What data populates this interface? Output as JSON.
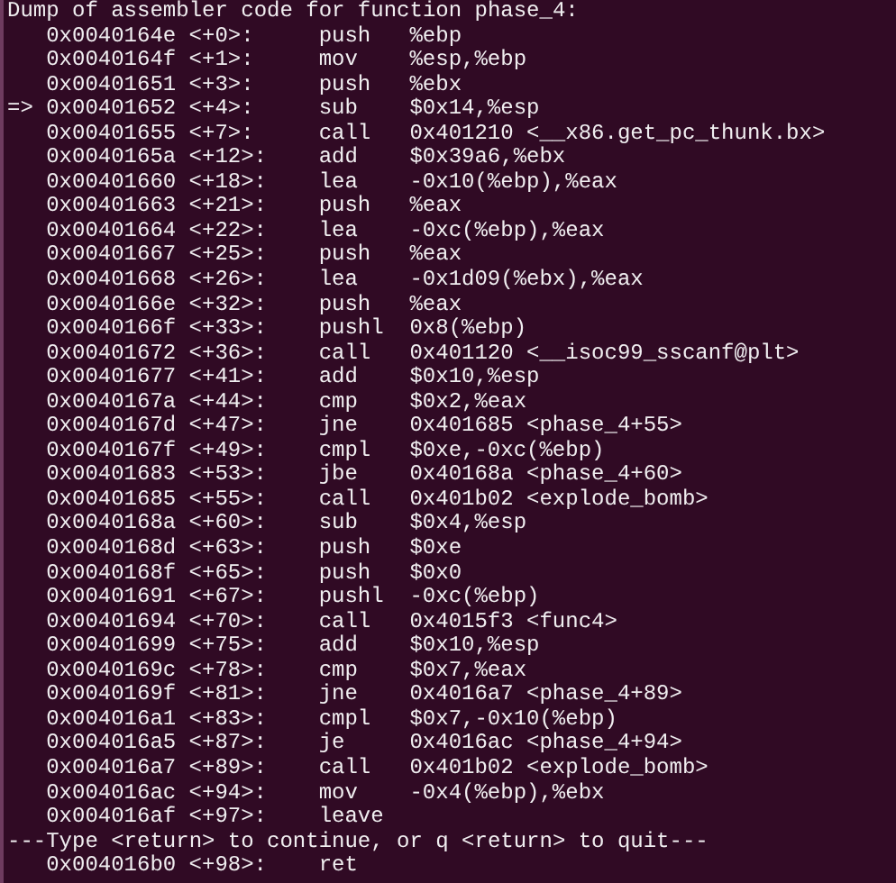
{
  "header": "Dump of assembler code for function phase_4:",
  "lines": [
    {
      "kind": "instruction",
      "address": "0x0040164e",
      "offset": "<+0>:",
      "mnemonic": "push",
      "operands": "%ebp"
    },
    {
      "kind": "instruction",
      "address": "0x0040164f",
      "offset": "<+1>:",
      "mnemonic": "mov",
      "operands": "%esp,%ebp"
    },
    {
      "kind": "instruction",
      "address": "0x00401651",
      "offset": "<+3>:",
      "mnemonic": "push",
      "operands": "%ebx"
    },
    {
      "kind": "instruction",
      "marker": "=>",
      "address": "0x00401652",
      "offset": "<+4>:",
      "mnemonic": "sub",
      "operands": "$0x14,%esp"
    },
    {
      "kind": "instruction",
      "address": "0x00401655",
      "offset": "<+7>:",
      "mnemonic": "call",
      "operands": "0x401210 <__x86.get_pc_thunk.bx>"
    },
    {
      "kind": "instruction",
      "address": "0x0040165a",
      "offset": "<+12>:",
      "mnemonic": "add",
      "operands": "$0x39a6,%ebx"
    },
    {
      "kind": "instruction",
      "address": "0x00401660",
      "offset": "<+18>:",
      "mnemonic": "lea",
      "operands": "-0x10(%ebp),%eax"
    },
    {
      "kind": "instruction",
      "address": "0x00401663",
      "offset": "<+21>:",
      "mnemonic": "push",
      "operands": "%eax"
    },
    {
      "kind": "instruction",
      "address": "0x00401664",
      "offset": "<+22>:",
      "mnemonic": "lea",
      "operands": "-0xc(%ebp),%eax"
    },
    {
      "kind": "instruction",
      "address": "0x00401667",
      "offset": "<+25>:",
      "mnemonic": "push",
      "operands": "%eax"
    },
    {
      "kind": "instruction",
      "address": "0x00401668",
      "offset": "<+26>:",
      "mnemonic": "lea",
      "operands": "-0x1d09(%ebx),%eax"
    },
    {
      "kind": "instruction",
      "address": "0x0040166e",
      "offset": "<+32>:",
      "mnemonic": "push",
      "operands": "%eax"
    },
    {
      "kind": "instruction",
      "address": "0x0040166f",
      "offset": "<+33>:",
      "mnemonic": "pushl",
      "operands": "0x8(%ebp)"
    },
    {
      "kind": "instruction",
      "address": "0x00401672",
      "offset": "<+36>:",
      "mnemonic": "call",
      "operands": "0x401120 <__isoc99_sscanf@plt>"
    },
    {
      "kind": "instruction",
      "address": "0x00401677",
      "offset": "<+41>:",
      "mnemonic": "add",
      "operands": "$0x10,%esp"
    },
    {
      "kind": "instruction",
      "address": "0x0040167a",
      "offset": "<+44>:",
      "mnemonic": "cmp",
      "operands": "$0x2,%eax"
    },
    {
      "kind": "instruction",
      "address": "0x0040167d",
      "offset": "<+47>:",
      "mnemonic": "jne",
      "operands": "0x401685 <phase_4+55>"
    },
    {
      "kind": "instruction",
      "address": "0x0040167f",
      "offset": "<+49>:",
      "mnemonic": "cmpl",
      "operands": "$0xe,-0xc(%ebp)"
    },
    {
      "kind": "instruction",
      "address": "0x00401683",
      "offset": "<+53>:",
      "mnemonic": "jbe",
      "operands": "0x40168a <phase_4+60>"
    },
    {
      "kind": "instruction",
      "address": "0x00401685",
      "offset": "<+55>:",
      "mnemonic": "call",
      "operands": "0x401b02 <explode_bomb>"
    },
    {
      "kind": "instruction",
      "address": "0x0040168a",
      "offset": "<+60>:",
      "mnemonic": "sub",
      "operands": "$0x4,%esp"
    },
    {
      "kind": "instruction",
      "address": "0x0040168d",
      "offset": "<+63>:",
      "mnemonic": "push",
      "operands": "$0xe"
    },
    {
      "kind": "instruction",
      "address": "0x0040168f",
      "offset": "<+65>:",
      "mnemonic": "push",
      "operands": "$0x0"
    },
    {
      "kind": "instruction",
      "address": "0x00401691",
      "offset": "<+67>:",
      "mnemonic": "pushl",
      "operands": "-0xc(%ebp)"
    },
    {
      "kind": "instruction",
      "address": "0x00401694",
      "offset": "<+70>:",
      "mnemonic": "call",
      "operands": "0x4015f3 <func4>"
    },
    {
      "kind": "instruction",
      "address": "0x00401699",
      "offset": "<+75>:",
      "mnemonic": "add",
      "operands": "$0x10,%esp"
    },
    {
      "kind": "instruction",
      "address": "0x0040169c",
      "offset": "<+78>:",
      "mnemonic": "cmp",
      "operands": "$0x7,%eax"
    },
    {
      "kind": "instruction",
      "address": "0x0040169f",
      "offset": "<+81>:",
      "mnemonic": "jne",
      "operands": "0x4016a7 <phase_4+89>"
    },
    {
      "kind": "instruction",
      "address": "0x004016a1",
      "offset": "<+83>:",
      "mnemonic": "cmpl",
      "operands": "$0x7,-0x10(%ebp)"
    },
    {
      "kind": "instruction",
      "address": "0x004016a5",
      "offset": "<+87>:",
      "mnemonic": "je",
      "operands": "0x4016ac <phase_4+94>"
    },
    {
      "kind": "instruction",
      "address": "0x004016a7",
      "offset": "<+89>:",
      "mnemonic": "call",
      "operands": "0x401b02 <explode_bomb>"
    },
    {
      "kind": "instruction",
      "address": "0x004016ac",
      "offset": "<+94>:",
      "mnemonic": "mov",
      "operands": "-0x4(%ebp),%ebx"
    },
    {
      "kind": "instruction",
      "address": "0x004016af",
      "offset": "<+97>:",
      "mnemonic": "leave"
    },
    {
      "kind": "prompt",
      "text": "---Type <return> to continue, or q <return> to quit---"
    },
    {
      "kind": "instruction",
      "address": "0x004016b0",
      "offset": "<+98>:",
      "mnemonic": "ret"
    }
  ]
}
